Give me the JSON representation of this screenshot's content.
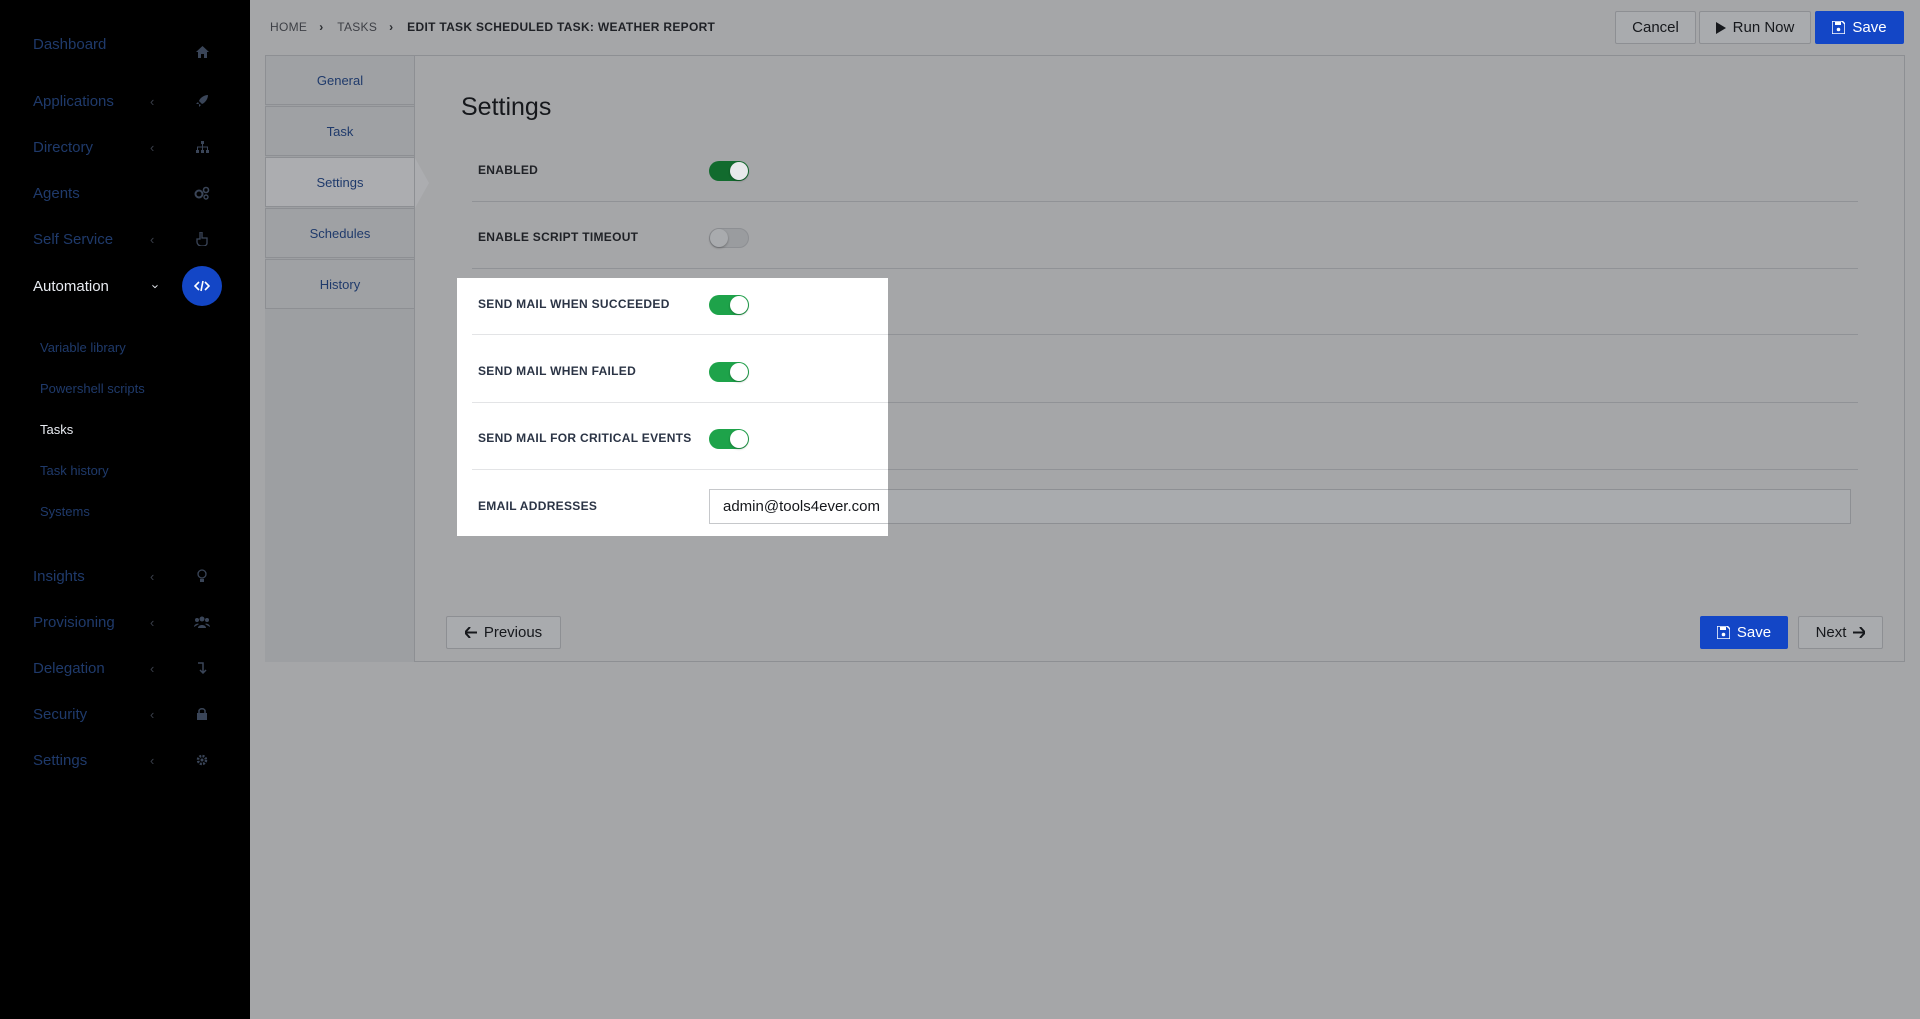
{
  "sidebar": {
    "items": [
      {
        "label": "Dashboard",
        "icon": "home-icon",
        "has_chevron": false
      },
      {
        "label": "Applications",
        "icon": "rocket-icon",
        "has_chevron": true
      },
      {
        "label": "Directory",
        "icon": "sitemap-icon",
        "has_chevron": true
      },
      {
        "label": "Agents",
        "icon": "cogs-icon",
        "has_chevron": false
      },
      {
        "label": "Self Service",
        "icon": "hand-pointer-icon",
        "has_chevron": true
      },
      {
        "label": "Automation",
        "icon": "code-icon",
        "has_chevron": true,
        "active": true
      },
      {
        "label": "Insights",
        "icon": "lightbulb-icon",
        "has_chevron": true
      },
      {
        "label": "Provisioning",
        "icon": "users-icon",
        "has_chevron": true
      },
      {
        "label": "Delegation",
        "icon": "arrow-turn-icon",
        "has_chevron": true
      },
      {
        "label": "Security",
        "icon": "lock-icon",
        "has_chevron": true
      },
      {
        "label": "Settings",
        "icon": "gear-icon",
        "has_chevron": true
      }
    ],
    "subitems": [
      {
        "label": "Variable library"
      },
      {
        "label": "Powershell scripts"
      },
      {
        "label": "Tasks",
        "current": true
      },
      {
        "label": "Task history"
      },
      {
        "label": "Systems"
      }
    ]
  },
  "breadcrumb": {
    "home": "HOME",
    "tasks": "TASKS",
    "current": "EDIT TASK SCHEDULED TASK: WEATHER REPORT"
  },
  "header_buttons": {
    "cancel": "Cancel",
    "run_now": "Run Now",
    "save": "Save"
  },
  "tabs": [
    {
      "label": "General"
    },
    {
      "label": "Task"
    },
    {
      "label": "Settings",
      "active": true
    },
    {
      "label": "Schedules"
    },
    {
      "label": "History"
    }
  ],
  "settings": {
    "title": "Settings",
    "enabled": {
      "label": "ENABLED",
      "value": true
    },
    "script_timeout": {
      "label": "ENABLE SCRIPT TIMEOUT",
      "value": false
    },
    "mail_succeeded": {
      "label": "SEND MAIL WHEN SUCCEEDED",
      "value": true
    },
    "mail_failed": {
      "label": "SEND MAIL WHEN FAILED",
      "value": true
    },
    "mail_critical": {
      "label": "SEND MAIL FOR CRITICAL EVENTS",
      "value": true
    },
    "email": {
      "label": "EMAIL ADDRESSES",
      "value": "admin@tools4ever.com"
    }
  },
  "footer_buttons": {
    "previous": "Previous",
    "save": "Save",
    "next": "Next"
  },
  "colors": {
    "accent": "#1346c6",
    "toggle_on": "#1ea34a",
    "sidebar_bg": "#000000"
  }
}
